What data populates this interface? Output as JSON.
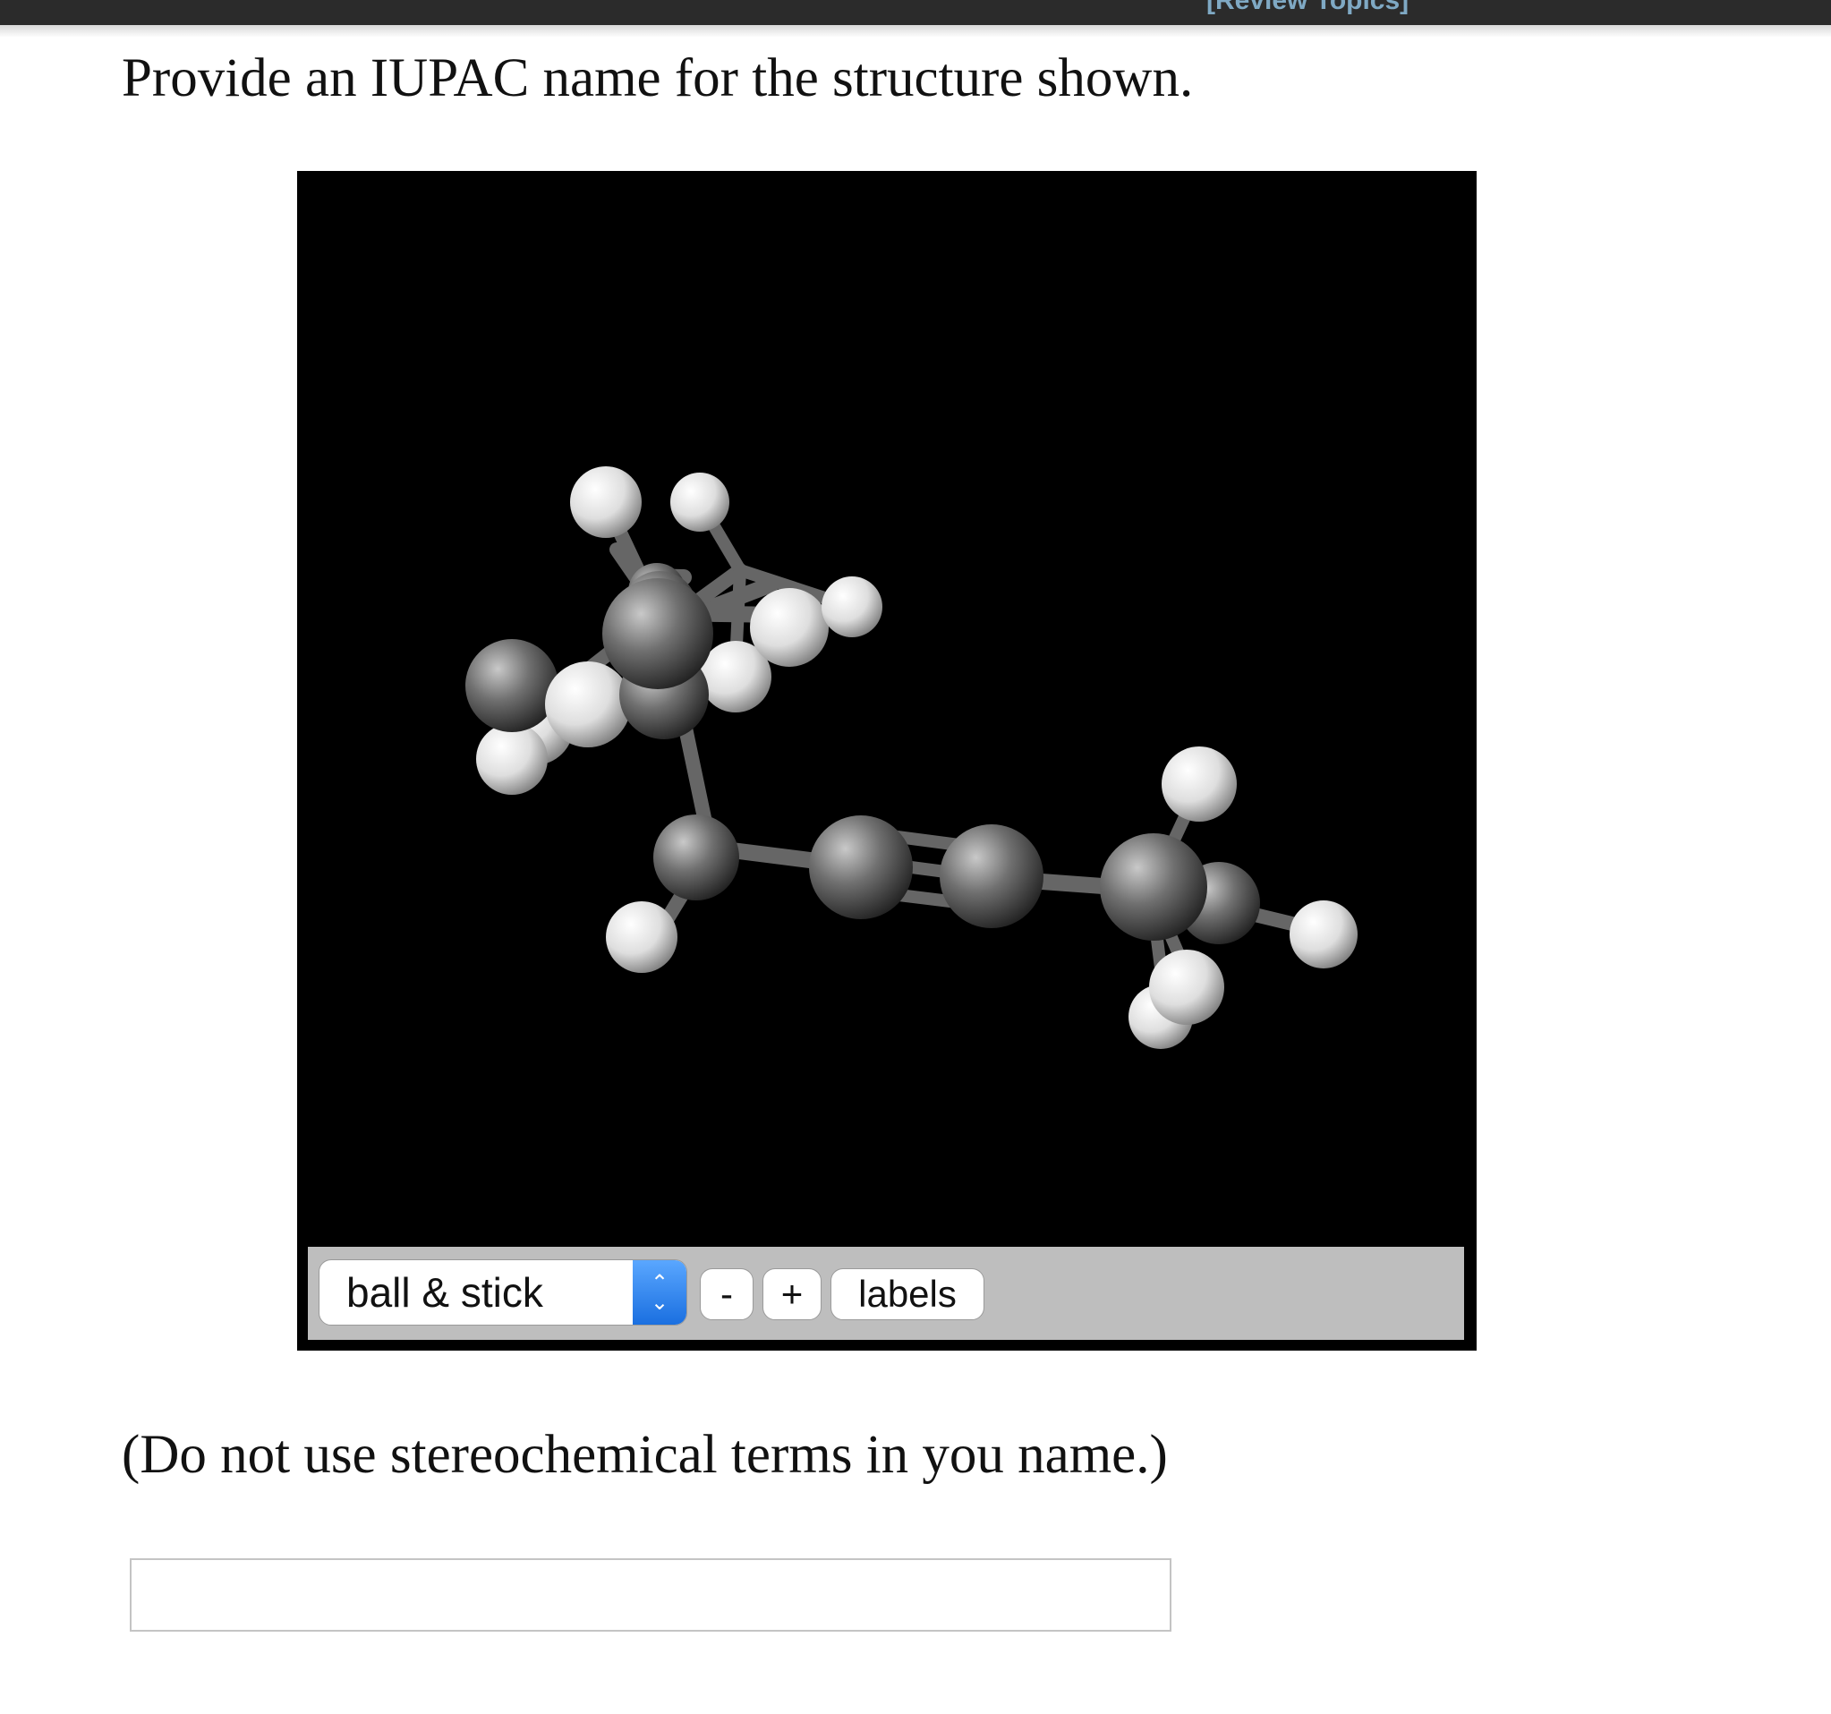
{
  "header": {
    "link_text": "[Review Topics]"
  },
  "question": {
    "prompt": "Provide an IUPAC name for the structure shown.",
    "note": "(Do not use stereochemical terms in you name.)",
    "answer_value": "",
    "answer_placeholder": ""
  },
  "viewer": {
    "render_mode": "ball & stick",
    "render_options": [
      "ball & stick"
    ],
    "zoom_out_label": "-",
    "zoom_in_label": "+",
    "labels_button": "labels"
  },
  "colors": {
    "carbon": "#6f6f6f",
    "hydrogen": "#e8e8e8",
    "bond": "#6a6a6a",
    "viewer_background": "#000000",
    "select_accent": "#1a6fe0"
  }
}
